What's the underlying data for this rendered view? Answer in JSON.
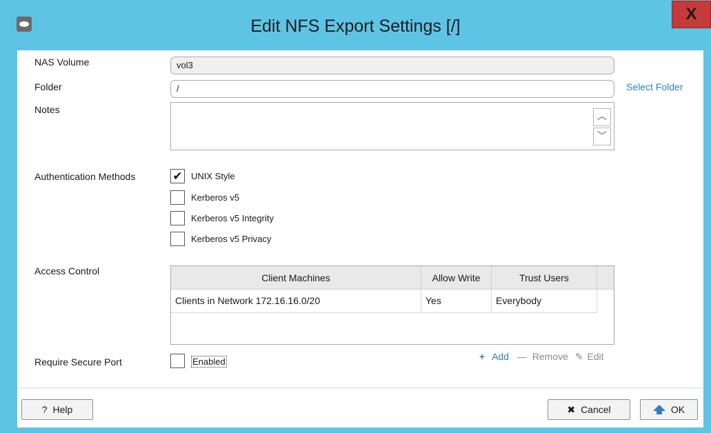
{
  "window": {
    "title": "Edit NFS Export Settings [/]",
    "close_label": "X"
  },
  "form": {
    "nas_volume_label": "NAS Volume",
    "nas_volume_value": "vol3",
    "folder_label": "Folder",
    "folder_value": "/",
    "select_folder_link": "Select Folder",
    "notes_label": "Notes",
    "notes_value": "",
    "auth_label": "Authentication Methods",
    "auth_methods": [
      {
        "label": "UNIX Style",
        "checked": true
      },
      {
        "label": "Kerberos v5",
        "checked": false
      },
      {
        "label": "Kerberos v5 Integrity",
        "checked": false
      },
      {
        "label": "Kerberos v5 Privacy",
        "checked": false
      }
    ],
    "access_label": "Access Control",
    "table": {
      "headers": [
        "Client Machines",
        "Allow Write",
        "Trust Users"
      ],
      "rows": [
        [
          "Clients in Network 172.16.16.0/20",
          "Yes",
          "Everybody"
        ]
      ]
    },
    "toolbar": {
      "add": "Add",
      "remove": "Remove",
      "edit": "Edit"
    },
    "secure_port_label": "Require Secure Port",
    "secure_port_checkbox_label": "Enabled",
    "secure_port_checked": false
  },
  "footer": {
    "help": "Help",
    "cancel": "Cancel",
    "ok": "OK"
  },
  "icons": {
    "check": "✔",
    "up": "︿",
    "down": "﹀",
    "plus": "+",
    "minus": "—",
    "pencil": "✎",
    "cancel_x": "✖",
    "help_q": "?"
  },
  "colors": {
    "frame": "#5ec4e6",
    "close": "#c73a3a",
    "link": "#2f7fc1"
  }
}
